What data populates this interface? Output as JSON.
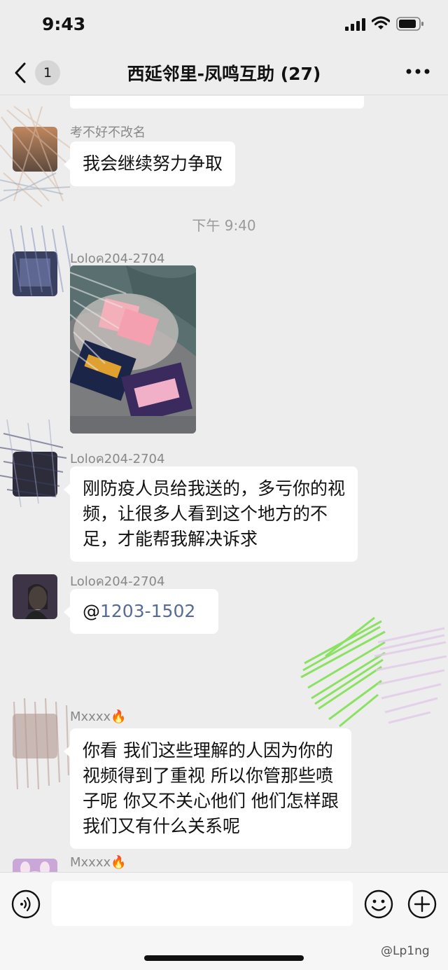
{
  "status_bar": {
    "time": "9:43"
  },
  "nav": {
    "back_badge": "1",
    "title": "西延邻里-凤鸣互助 (27)"
  },
  "messages": [
    {
      "sender": "考不好不改名",
      "text": "我会继续努力争取"
    },
    {
      "time_divider": "下午 9:40"
    },
    {
      "sender": "Loloค204-2704",
      "type": "image"
    },
    {
      "sender": "Loloค204-2704",
      "lines": [
        "刚防疫人员给我送的，多亏你的视",
        "频，让很多人看到这个地方的不",
        "足，才能帮我解决诉求"
      ]
    },
    {
      "sender": "Loloค204-2704",
      "mention_prefix": "@",
      "mention": "1203-1502"
    },
    {
      "sender": "Mxxxx🔥",
      "lines": [
        "你看 我们这些理解的人因为你的",
        "视频得到了重视 所以你管那些喷",
        "子呢 你又不关心他们 他们怎样跟",
        "我们又有什么关系呢"
      ]
    },
    {
      "sender": "Mxxxx🔥"
    }
  ],
  "watermark": "@Lp1ng",
  "icons": {
    "signal": "signal-icon",
    "wifi": "wifi-icon",
    "battery": "battery-icon",
    "back": "chevron-left-icon",
    "more": "more-icon",
    "voice": "voice-icon",
    "emoji": "emoji-icon",
    "plus": "plus-icon"
  },
  "colors": {
    "background": "#ededed",
    "bubble": "#ffffff",
    "mention": "#576b95",
    "scribble_green": "#7be04a"
  }
}
